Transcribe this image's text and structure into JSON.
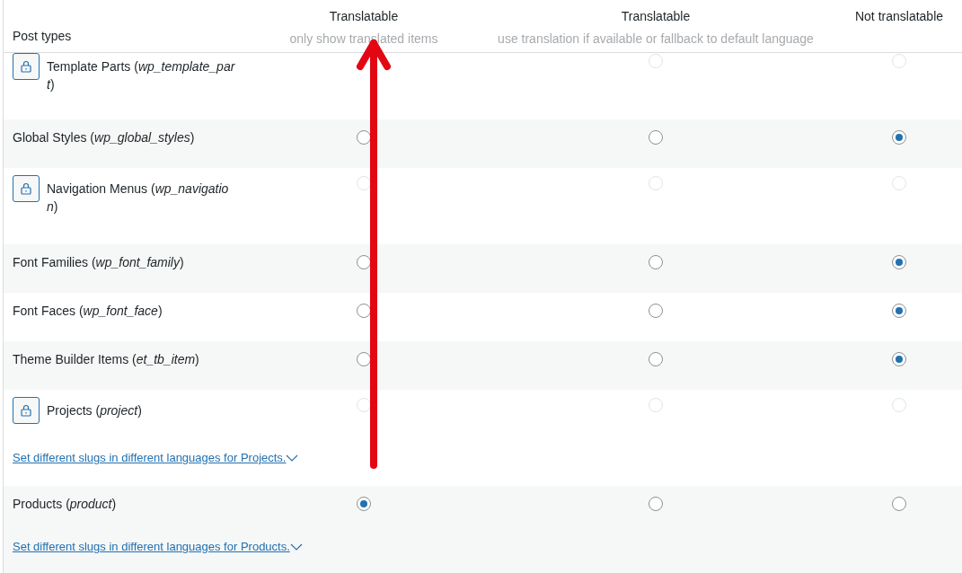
{
  "header": {
    "post_types": "Post types",
    "columns": [
      {
        "title": "Translatable",
        "subtitle": "only show translated items"
      },
      {
        "title": "Translatable",
        "subtitle": "use translation if available or fallback to default language"
      },
      {
        "title": "Not translatable"
      }
    ]
  },
  "rows": [
    {
      "label": "Template Parts (*wp_template_part*)",
      "locked": true,
      "options": [
        {
          "selected": false
        },
        {
          "selected": false
        }
      ]
    },
    {
      "label": "Global Styles (*wp_global_styles*)",
      "locked": false,
      "options": [
        {
          "selected": false
        },
        {
          "selected": false
        },
        {
          "selected": true
        }
      ]
    },
    {
      "label": "Navigation Menus (*wp_navigation*)",
      "locked": true,
      "options": [
        {
          "selected": false
        },
        {
          "selected": false
        },
        {
          "selected": false
        }
      ]
    },
    {
      "label": "Font Families (*wp_font_family*)",
      "locked": false,
      "options": [
        {
          "selected": false
        },
        {
          "selected": false
        },
        {
          "selected": true
        }
      ]
    },
    {
      "label": "Font Faces (*wp_font_face*)",
      "locked": false,
      "options": [
        {
          "selected": false
        },
        {
          "selected": false
        },
        {
          "selected": true
        }
      ]
    },
    {
      "label": "Theme Builder Items (*et_tb_item*)",
      "locked": false,
      "options": [
        {
          "selected": false
        },
        {
          "selected": false
        },
        {
          "selected": true
        }
      ]
    },
    {
      "label": "Projects (*project*)",
      "locked": true,
      "options": [
        {
          "selected": false
        },
        {
          "selected": false
        },
        {
          "selected": false
        }
      ],
      "slug_link": "Set different slugs in different languages for Projects."
    },
    {
      "label": "Products (*product*)",
      "locked": false,
      "options": [
        {
          "selected": true
        },
        {
          "selected": false
        },
        {
          "selected": false
        }
      ],
      "slug_link": "Set different slugs in different languages for Products."
    }
  ]
}
